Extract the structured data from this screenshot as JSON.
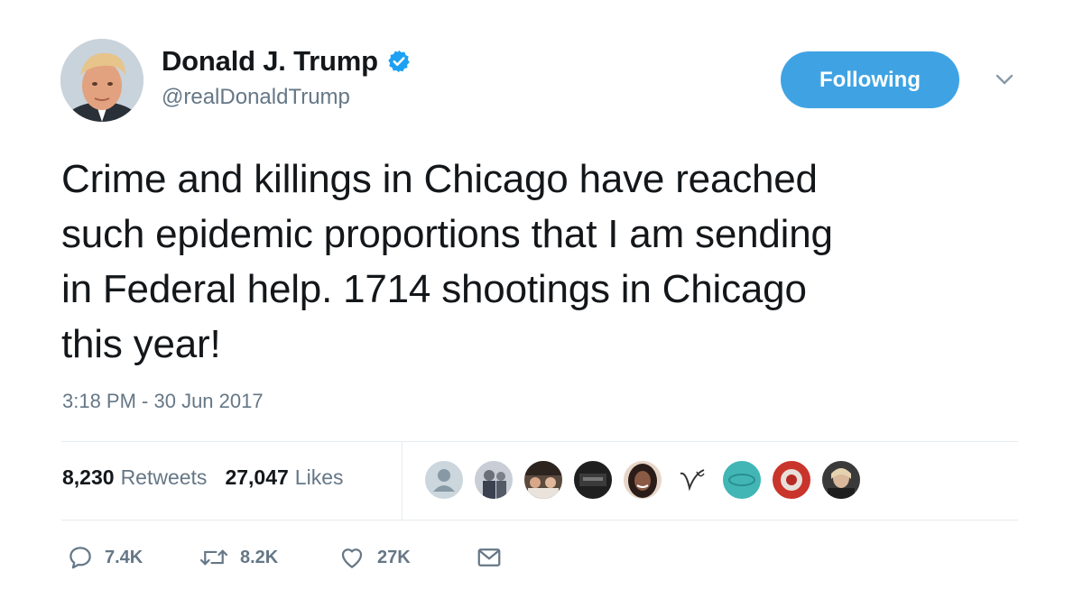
{
  "user": {
    "display_name": "Donald J. Trump",
    "handle": "@realDonaldTrump",
    "verified": true,
    "avatar_icon": "profile-photo"
  },
  "follow_button": {
    "label": "Following",
    "color": "#3fa3e3"
  },
  "menu_icon": "chevron-down-icon",
  "tweet": {
    "lines": [
      "Crime and killings in Chicago have reached",
      "such epidemic proportions that I am sending",
      "in Federal help. 1714 shootings in Chicago",
      "this year!"
    ],
    "timestamp": "3:18 PM - 30 Jun 2017"
  },
  "stats": {
    "retweets_count": "8,230",
    "retweets_label": "Retweets",
    "likes_count": "27,047",
    "likes_label": "Likes"
  },
  "likers": [
    {
      "icon": "default-avatar",
      "color": "#ccd6dd"
    },
    {
      "icon": "person-avatar",
      "color": "#8a8f9a"
    },
    {
      "icon": "group-photo-avatar",
      "color": "#a07860"
    },
    {
      "icon": "dark-avatar",
      "color": "#2b2b2b"
    },
    {
      "icon": "person-avatar",
      "color": "#3a2a24"
    },
    {
      "icon": "script-logo-avatar",
      "color": "#ffffff"
    },
    {
      "icon": "teal-avatar",
      "color": "#41b6b5"
    },
    {
      "icon": "red-avatar",
      "color": "#c9342b"
    },
    {
      "icon": "person-avatar",
      "color": "#454545"
    }
  ],
  "actions": {
    "reply_icon": "reply-icon",
    "reply_count": "7.4K",
    "retweet_icon": "retweet-icon",
    "retweet_count": "8.2K",
    "like_icon": "heart-icon",
    "like_count": "27K",
    "dm_icon": "envelope-icon"
  },
  "colors": {
    "text": "#14171a",
    "secondary": "#657786",
    "verified_badge": "#1da1f2",
    "divider": "#e6ecf0"
  }
}
